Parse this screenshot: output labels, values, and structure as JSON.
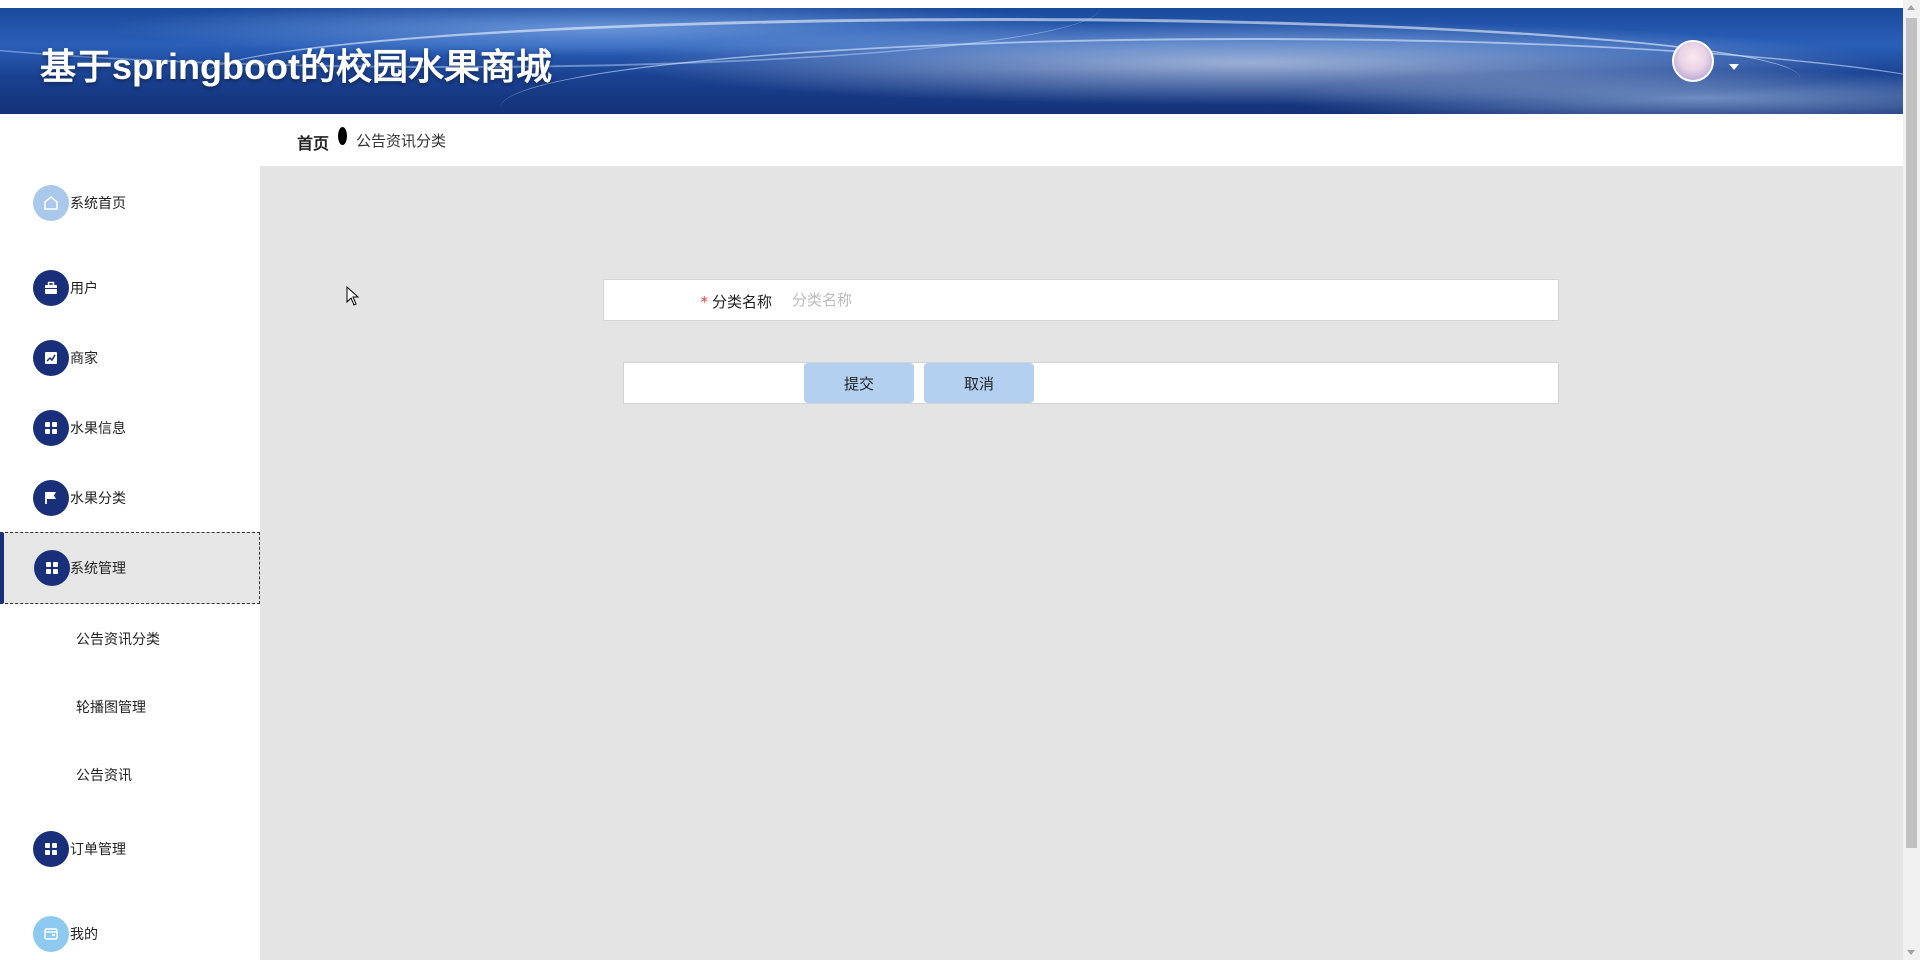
{
  "header": {
    "title": "基于springboot的校园水果商城"
  },
  "breadcrumb": {
    "home": "首页",
    "current": "公告资讯分类"
  },
  "sidebar": {
    "items": [
      {
        "label": "系统首页",
        "icon": "home-icon"
      },
      {
        "label": "用户",
        "icon": "briefcase-icon"
      },
      {
        "label": "商家",
        "icon": "chart-icon"
      },
      {
        "label": "水果信息",
        "icon": "grid-icon"
      },
      {
        "label": "水果分类",
        "icon": "flag-icon"
      },
      {
        "label": "系统管理",
        "icon": "grid-icon"
      },
      {
        "label": "订单管理",
        "icon": "grid-icon"
      },
      {
        "label": "我的",
        "icon": "wallet-icon"
      }
    ],
    "submenu": [
      {
        "label": "公告资讯分类"
      },
      {
        "label": "轮播图管理"
      },
      {
        "label": "公告资讯"
      }
    ]
  },
  "form": {
    "required_mark": "*",
    "field_label": "分类名称",
    "field_value": "",
    "field_placeholder": "分类名称",
    "submit_label": "提交",
    "cancel_label": "取消"
  },
  "colors": {
    "sidebar_icon_dark": "#1a2f7a",
    "sidebar_icon_light": "#a9c8ec",
    "main_background": "#e4e4e5",
    "button_background": "#b4d0f1",
    "required": "#e23b3b"
  }
}
